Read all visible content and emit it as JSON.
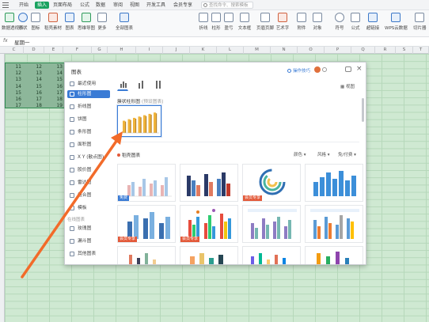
{
  "menubar": {
    "items": [
      {
        "label": "开始",
        "active": false
      },
      {
        "label": "插入",
        "active": true
      },
      {
        "label": "页面布局",
        "active": false
      },
      {
        "label": "公式",
        "active": false
      },
      {
        "label": "数据",
        "active": false
      },
      {
        "label": "审阅",
        "active": false
      },
      {
        "label": "视图",
        "active": false
      },
      {
        "label": "开发工具",
        "active": false
      },
      {
        "label": "会员专享",
        "active": false
      }
    ],
    "search_placeholder": "查找命令、搜索模板"
  },
  "ribbon": {
    "buttons": [
      {
        "label": "数据透视表",
        "icon": "pivot-table-icon"
      },
      {
        "label": "形状",
        "icon": "shapes-icon"
      },
      {
        "label": "图标",
        "icon": "icons-icon"
      },
      {
        "label": "稻壳素材",
        "icon": "material-icon"
      },
      {
        "label": "图表",
        "icon": "chart-icon"
      },
      {
        "label": "思维导图",
        "icon": "mindmap-icon"
      },
      {
        "label": "更多",
        "icon": "more-icon"
      },
      {
        "label": "全部图表",
        "icon": "all-charts-icon"
      },
      {
        "label": "折线",
        "icon": "line-chart-icon"
      },
      {
        "label": "柱形",
        "icon": "column-chart-icon"
      },
      {
        "label": "盈亏",
        "icon": "win-loss-icon"
      },
      {
        "label": "文本框",
        "icon": "textbox-icon"
      },
      {
        "label": "页眉页脚",
        "icon": "header-footer-icon"
      },
      {
        "label": "艺术字",
        "icon": "wordart-icon"
      },
      {
        "label": "附件",
        "icon": "attachment-icon"
      },
      {
        "label": "对象",
        "icon": "object-icon"
      },
      {
        "label": "符号",
        "icon": "symbol-icon"
      },
      {
        "label": "公式",
        "icon": "formula-icon"
      },
      {
        "label": "超链接",
        "icon": "hyperlink-icon"
      },
      {
        "label": "WPS云数据",
        "icon": "cloud-data-icon"
      },
      {
        "label": "切片器",
        "icon": "slicer-icon"
      }
    ]
  },
  "formula_bar": {
    "fx": "fx",
    "value": "星期一"
  },
  "sheet": {
    "columns": [
      "C",
      "D",
      "E",
      "F",
      "G",
      "H",
      "I",
      "J",
      "K",
      "L",
      "M",
      "N",
      "O",
      "P",
      "Q",
      "R",
      "S",
      "T"
    ],
    "rows": [
      [
        "11",
        "12",
        "13"
      ],
      [
        "12",
        "13",
        "14"
      ],
      [
        "13",
        "14",
        "15"
      ],
      [
        "14",
        "15",
        "16"
      ],
      [
        "15",
        "16",
        "17"
      ],
      [
        "16",
        "17",
        "18"
      ],
      [
        "17",
        "18",
        "19"
      ]
    ]
  },
  "dialog": {
    "title": "图表",
    "tips": "操作技巧",
    "sidebar": [
      {
        "label": "最近使用",
        "icon": "recent-icon",
        "active": false
      },
      {
        "label": "柱形图",
        "icon": "column-chart-icon",
        "active": true
      },
      {
        "label": "折线图",
        "icon": "line-chart-icon",
        "active": false
      },
      {
        "label": "饼图",
        "icon": "pie-chart-icon",
        "active": false
      },
      {
        "label": "条形图",
        "icon": "bar-chart-icon",
        "active": false
      },
      {
        "label": "面积图",
        "icon": "area-chart-icon",
        "active": false
      },
      {
        "label": "X Y (散点图)",
        "icon": "scatter-chart-icon",
        "active": false
      },
      {
        "label": "股价图",
        "icon": "stock-chart-icon",
        "active": false
      },
      {
        "label": "雷达图",
        "icon": "radar-chart-icon",
        "active": false
      },
      {
        "label": "组合图",
        "icon": "combo-chart-icon",
        "active": false
      },
      {
        "label": "模板",
        "icon": "template-icon",
        "active": false
      }
    ],
    "sidebar_group": "在线图表",
    "sidebar_online": [
      {
        "label": "玫瑰图",
        "icon": "rose-chart-icon"
      },
      {
        "label": "漏斗图",
        "icon": "funnel-chart-icon"
      },
      {
        "label": "其他图表",
        "icon": "other-charts-icon"
      }
    ],
    "view_toggle": "视图",
    "preview_title": "簇状柱形图",
    "preview_subtitle": "(预设图表)",
    "section_label": "稻壳图表",
    "filters": [
      "颜色",
      "风格",
      "免/付费"
    ],
    "templates": [
      {
        "badge": "免费",
        "badge_color": "#3a7bd5"
      },
      {
        "badge": "",
        "badge_color": ""
      },
      {
        "badge": "",
        "badge_color": ""
      },
      {
        "badge": "",
        "badge_color": ""
      },
      {
        "badge": "",
        "badge_color": ""
      },
      {
        "badge": "",
        "badge_color": ""
      },
      {
        "badge": "",
        "badge_color": ""
      },
      {
        "badge": "",
        "badge_color": ""
      }
    ],
    "member_badge": "会员专享"
  },
  "colors": {
    "accent": "#1aa260",
    "selection": "#8db79a",
    "dialog_accent": "#3a7bd5",
    "annotation": "#f26b2a",
    "preview_bars": "#f0b43c"
  }
}
